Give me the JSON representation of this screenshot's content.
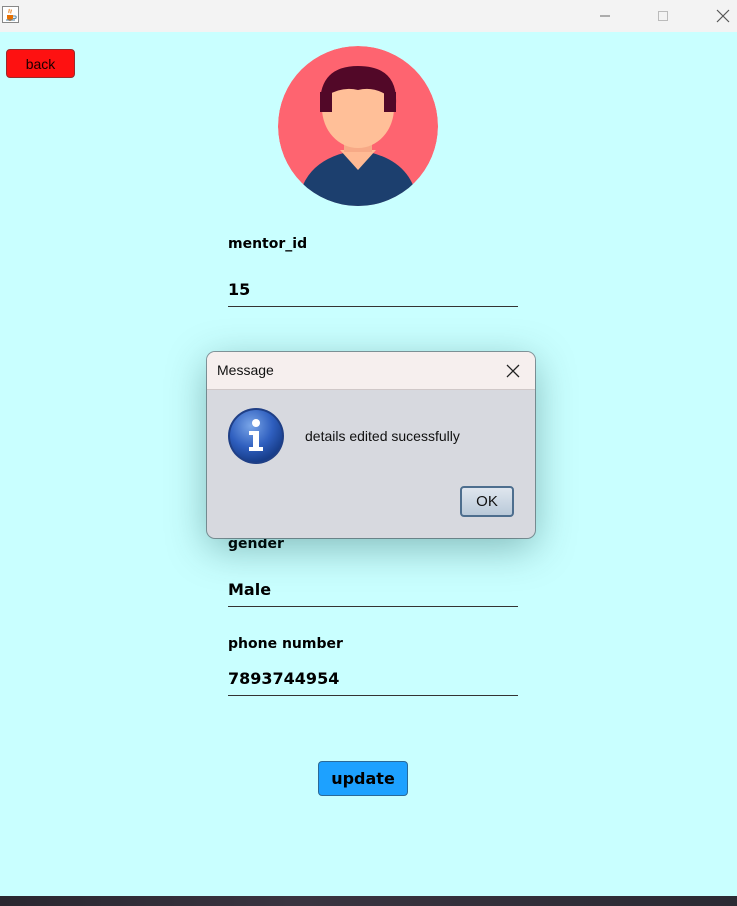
{
  "window": {
    "icon": "java-cup-icon",
    "controls": [
      "minimize-icon",
      "maximize-icon",
      "close-icon"
    ]
  },
  "back_button": {
    "label": "back",
    "color": "#fe1111"
  },
  "avatar": {
    "icon": "user-avatar-icon",
    "bg_color": "#fe6470"
  },
  "form": {
    "mentor_id_label": "mentor_id",
    "mentor_id_value": "15",
    "gender_label": "gender",
    "gender_value": "Male",
    "phone_label": "phone number",
    "phone_value": "7893744954"
  },
  "update_button": {
    "label": "update",
    "color": "#1da1ff"
  },
  "dialog": {
    "title": "Message",
    "message": "details edited sucessfully",
    "ok_label": "OK",
    "icon": "info-icon"
  },
  "colors": {
    "background": "#c9ffff"
  }
}
